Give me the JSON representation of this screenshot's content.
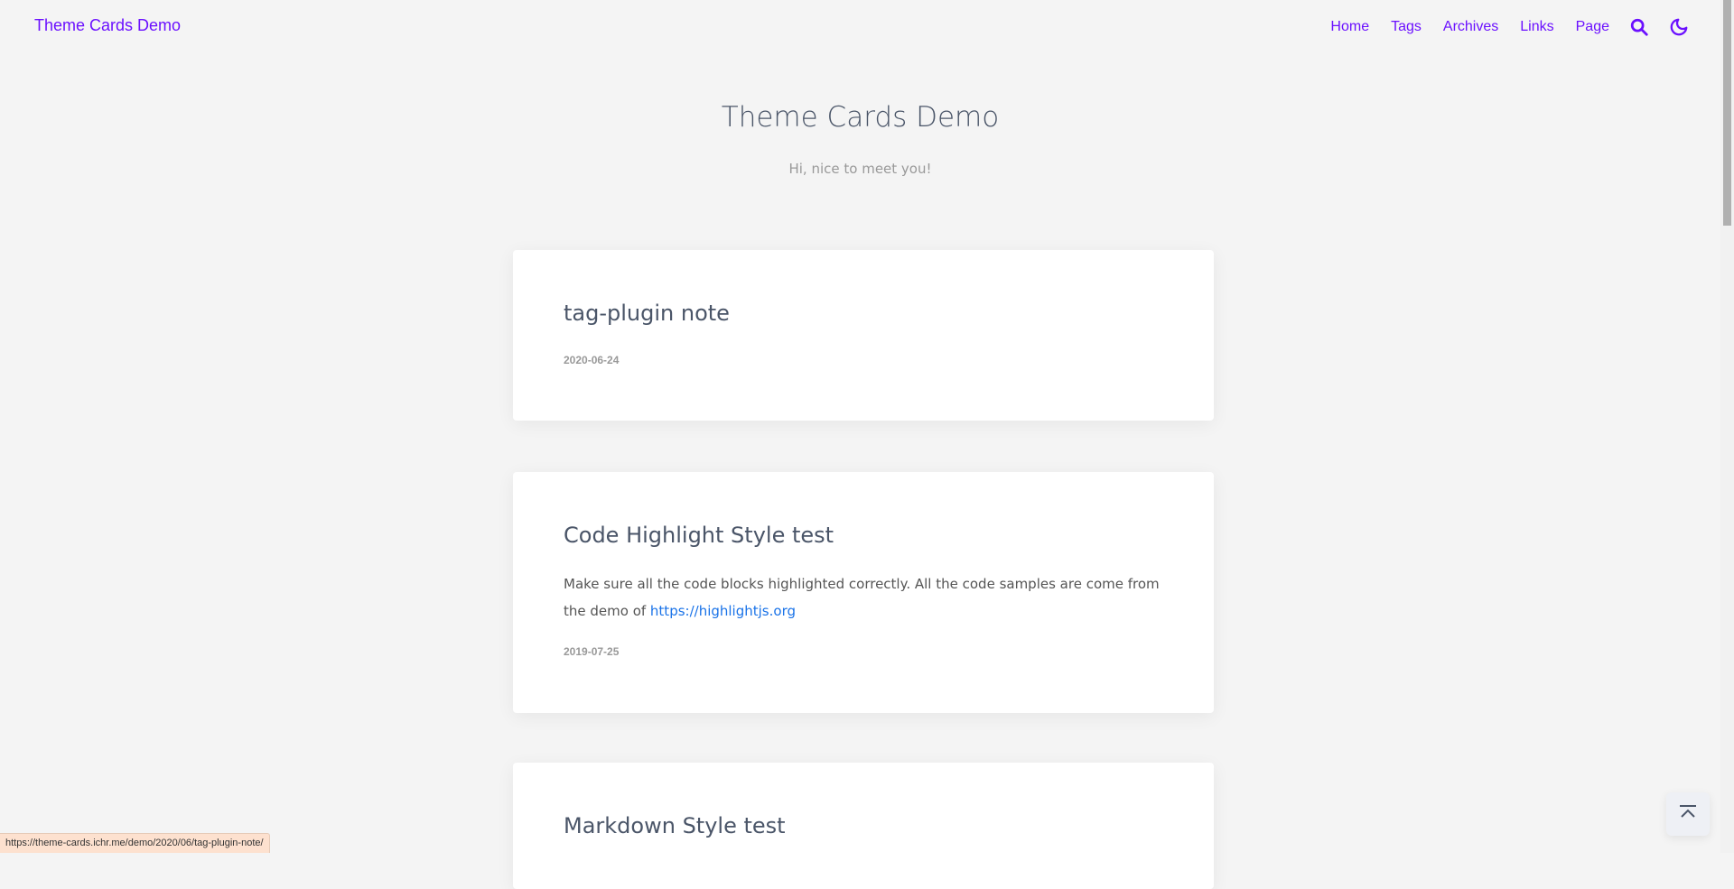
{
  "nav": {
    "brand": "Theme Cards Demo",
    "items": [
      {
        "label": "Home"
      },
      {
        "label": "Tags"
      },
      {
        "label": "Archives"
      },
      {
        "label": "Links"
      },
      {
        "label": "Page"
      }
    ],
    "icons": [
      "search-icon",
      "moon-icon"
    ],
    "accent_color": "#6b10ff"
  },
  "hero": {
    "title": "Theme Cards Demo",
    "subtitle": "Hi, nice to meet you!"
  },
  "posts": [
    {
      "title": "tag-plugin note",
      "date": "2020-06-24"
    },
    {
      "title": "Code Highlight Style test",
      "excerpt": "Make sure all the code blocks highlighted correctly. All the code samples are come from the demo of ",
      "link": "https://highlightjs.org",
      "date": "2019-07-25"
    },
    {
      "title": "Markdown Style test"
    }
  ],
  "status_bar": {
    "url": "https://theme-cards.ichr.me/demo/2020/06/tag-plugin-note/"
  },
  "back_to_top": {
    "icon": "arrow-up-to-top-icon"
  }
}
